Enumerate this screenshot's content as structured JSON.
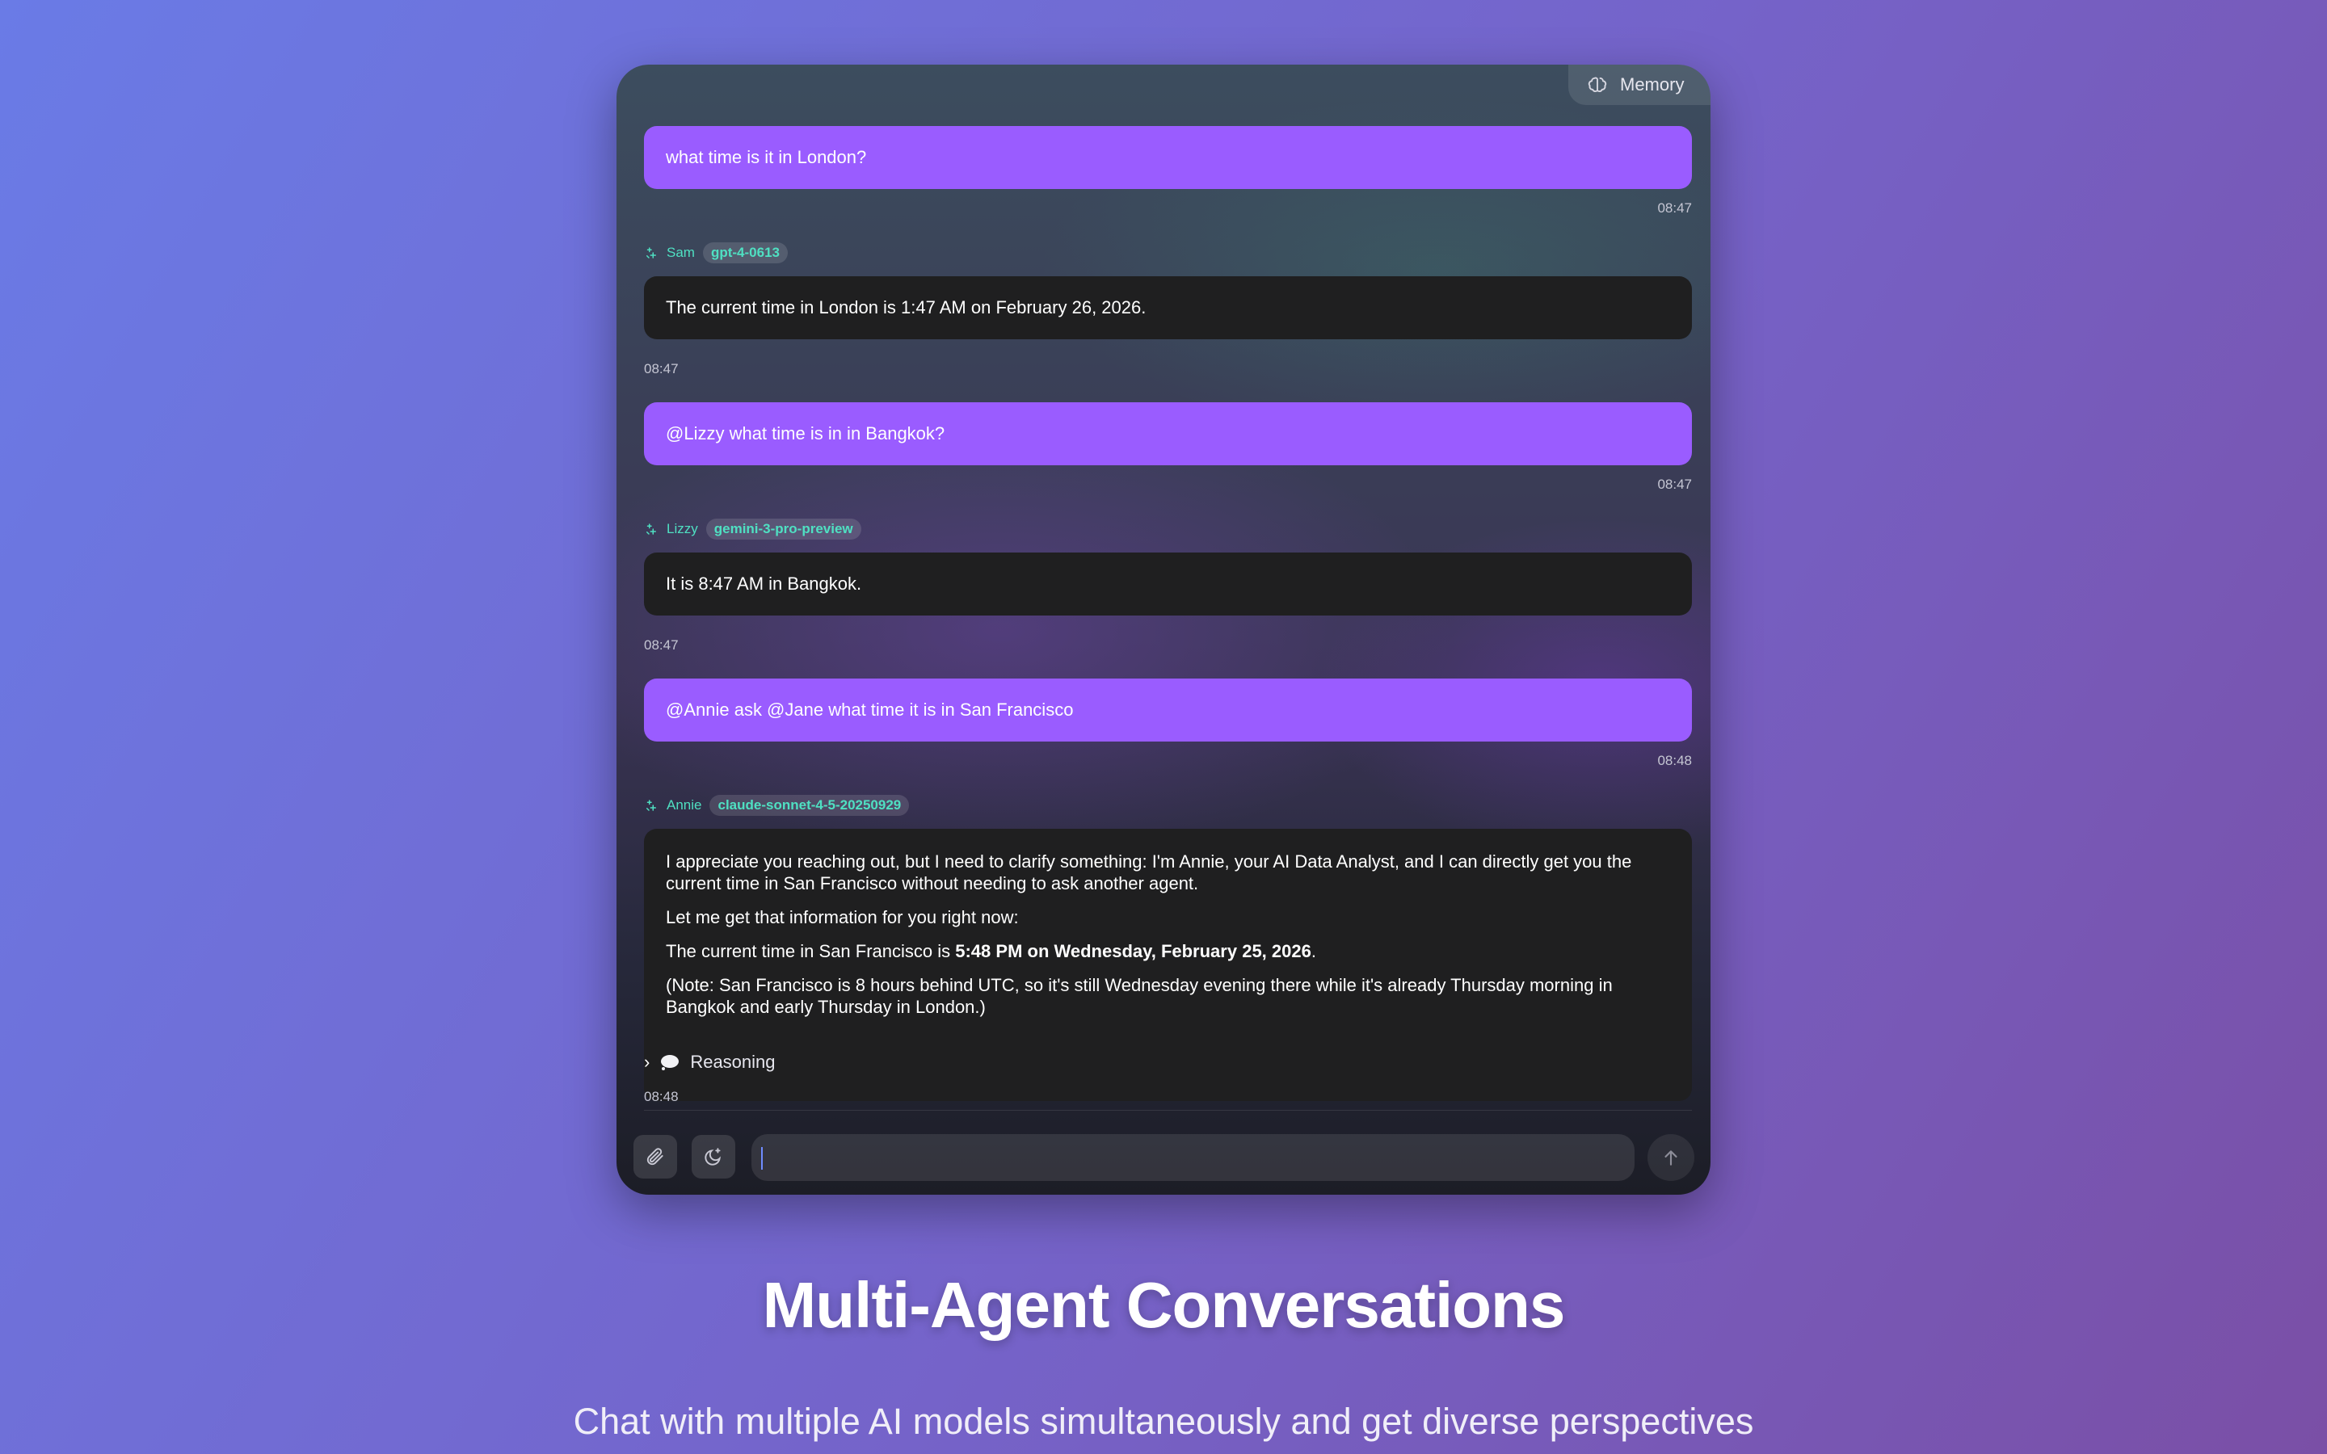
{
  "memory_button": {
    "label": "Memory",
    "icon": "brain-icon"
  },
  "messages": [
    {
      "role": "user",
      "text": "what time is it in London?",
      "time": "08:47"
    },
    {
      "role": "agent",
      "agent": "Sam",
      "model": "gpt-4-0613",
      "text": "The current time in London is 1:47 AM on February 26, 2026.",
      "time": "08:47"
    },
    {
      "role": "user",
      "text": "@Lizzy what time is in in Bangkok?",
      "time": "08:47"
    },
    {
      "role": "agent",
      "agent": "Lizzy",
      "model": "gemini-3-pro-preview",
      "text": "It is 8:47 AM in Bangkok.",
      "time": "08:47"
    },
    {
      "role": "user",
      "text": "@Annie ask @Jane what time it is in San Francisco",
      "time": "08:48"
    },
    {
      "role": "agent",
      "agent": "Annie",
      "model": "claude-sonnet-4-5-20250929",
      "paragraphs": {
        "p1": "I appreciate you reaching out, but I need to clarify something: I'm Annie, your AI Data Analyst, and I can directly get you the current time in San Francisco without needing to ask another agent.",
        "p2": "Let me get that information for you right now:",
        "p3_prefix": "The current time in San Francisco is ",
        "p3_bold": "5:48 PM on Wednesday, February 25, 2026",
        "p3_suffix": ".",
        "p4": "(Note: San Francisco is 8 hours behind UTC, so it's still Wednesday evening there while it's already Thursday morning in Bangkok and early Thursday in London.)"
      },
      "reasoning_label": "Reasoning",
      "time": "08:48"
    }
  ],
  "composer": {
    "attach_icon": "paperclip-icon",
    "mode_icon": "moon-sparkle-icon",
    "input_value": "",
    "send_icon": "arrow-up-icon"
  },
  "headline": "Multi-Agent Conversations",
  "subheadline": "Chat with multiple AI models simultaneously and get diverse perspectives",
  "colors": {
    "user_bubble": "#9a5cff",
    "agent_bubble": "#1f1f20",
    "agent_accent": "#4fe0c2"
  }
}
